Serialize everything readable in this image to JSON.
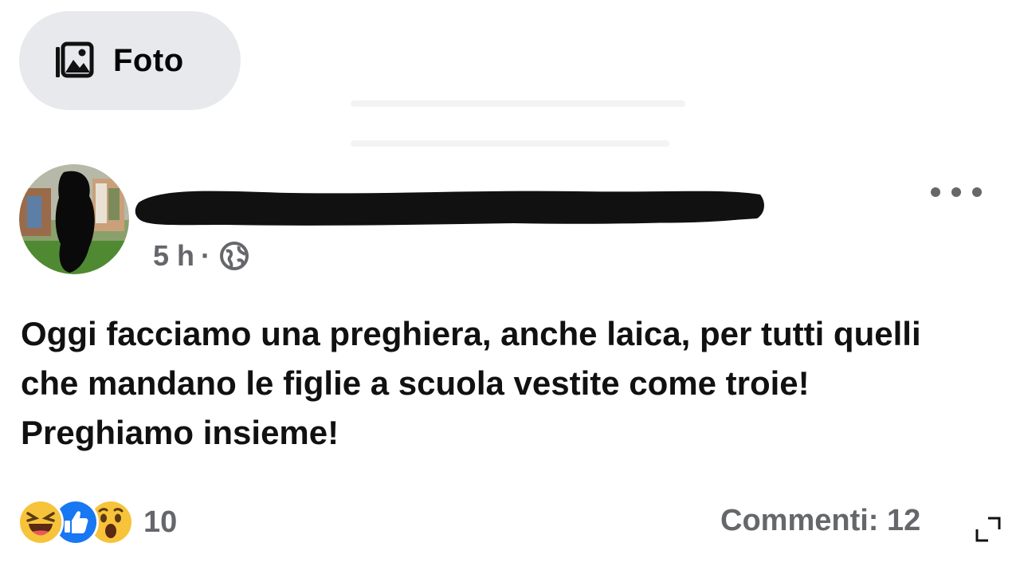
{
  "photo_chip": {
    "label": "Foto",
    "icon": "photo-gallery-icon"
  },
  "post": {
    "author_name_redacted": true,
    "timestamp": "5 h",
    "separator": "·",
    "audience_icon": "globe-icon",
    "text": "Oggi facciamo una preghiera, anche laica, per tutti quelli che mandano le figlie a scuola vestite come troie! Preghiamo insieme!",
    "more_icon": "more-options-icon"
  },
  "footer": {
    "reactions": [
      "haha-icon",
      "like-icon",
      "wow-icon"
    ],
    "reaction_count": "10",
    "comments_label": "Commenti: 12",
    "expand_icon": "expand-corner-icon"
  },
  "colors": {
    "chip_bg": "#e8e9ed",
    "secondary_text": "#65676b",
    "primary_text": "#050505",
    "like_blue": "#1877f2",
    "emoji_yellow": "#f7c33a"
  }
}
